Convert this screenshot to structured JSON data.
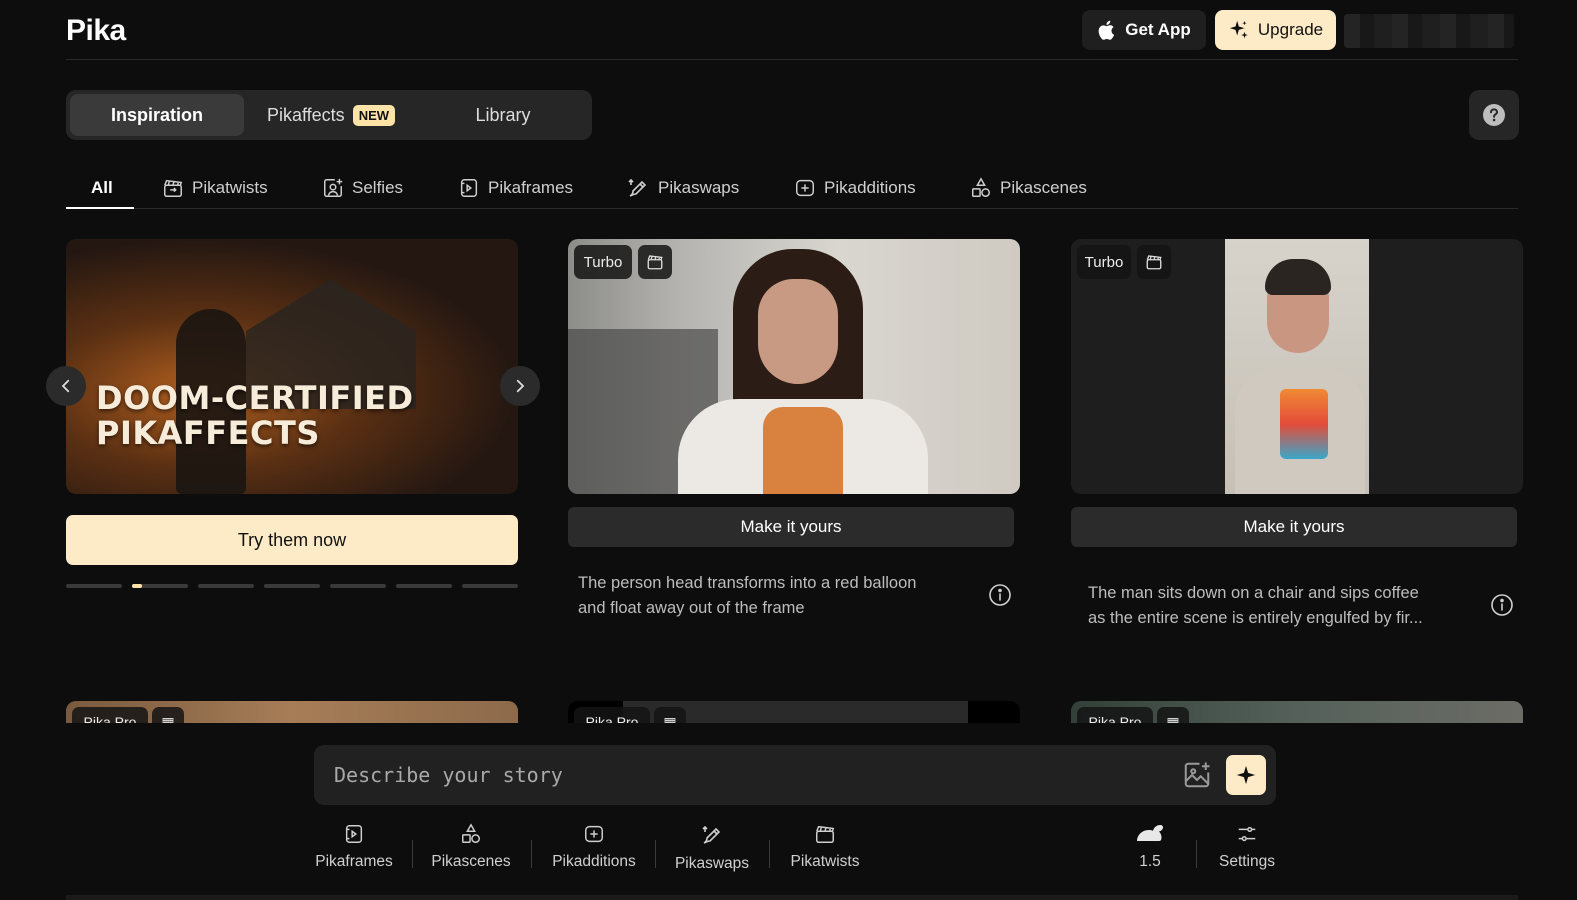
{
  "header": {
    "logo": "Pika",
    "get_app": "Get App",
    "upgrade": "Upgrade"
  },
  "main_tabs": [
    {
      "label": "Inspiration",
      "active": true
    },
    {
      "label": "Pikaffects",
      "badge": "NEW"
    },
    {
      "label": "Library"
    }
  ],
  "filter_tabs": [
    {
      "label": "All",
      "active": true
    },
    {
      "label": "Pikatwists",
      "icon": "clapper-icon"
    },
    {
      "label": "Selfies",
      "icon": "selfie-icon"
    },
    {
      "label": "Pikaframes",
      "icon": "frames-icon"
    },
    {
      "label": "Pikaswaps",
      "icon": "swap-brush-icon"
    },
    {
      "label": "Pikadditions",
      "icon": "add-frame-icon"
    },
    {
      "label": "Pikascenes",
      "icon": "shapes-icon"
    }
  ],
  "hero": {
    "headline_line1": "DOOM-CERTIFIED",
    "headline_line2": "PIKAFFECTS",
    "cta": "Try them now",
    "dot_count": 7,
    "active_dot": 1
  },
  "cards": [
    {
      "tag": "Turbo",
      "button": "Make it yours",
      "prompt_line1": "The person head transforms into a red balloon",
      "prompt_line2": "and float away out of the frame"
    },
    {
      "tag": "Turbo",
      "button": "Make it yours",
      "prompt_line1": "The man sits down on a chair and sips coffee",
      "prompt_line2": "as the entire scene is entirely engulfed by fir..."
    }
  ],
  "row2_tags": [
    "Pika Pro",
    "Pika Pro",
    "Pika Pro"
  ],
  "composer": {
    "placeholder": "Describe your story",
    "value": ""
  },
  "tools": [
    {
      "label": "Pikaframes",
      "icon": "frames-icon"
    },
    {
      "label": "Pikascenes",
      "icon": "shapes-icon"
    },
    {
      "label": "Pikadditions",
      "icon": "add-frame-icon"
    },
    {
      "label": "Pikaswaps",
      "icon": "swap-brush-icon"
    },
    {
      "label": "Pikatwists",
      "icon": "clapper-icon"
    }
  ],
  "model": {
    "label": "1.5",
    "icon": "rabbit-icon"
  },
  "settings": {
    "label": "Settings",
    "icon": "sliders-icon"
  },
  "colors": {
    "background": "#0d0d0d",
    "accent": "#fdebc8",
    "panel": "#262626"
  }
}
